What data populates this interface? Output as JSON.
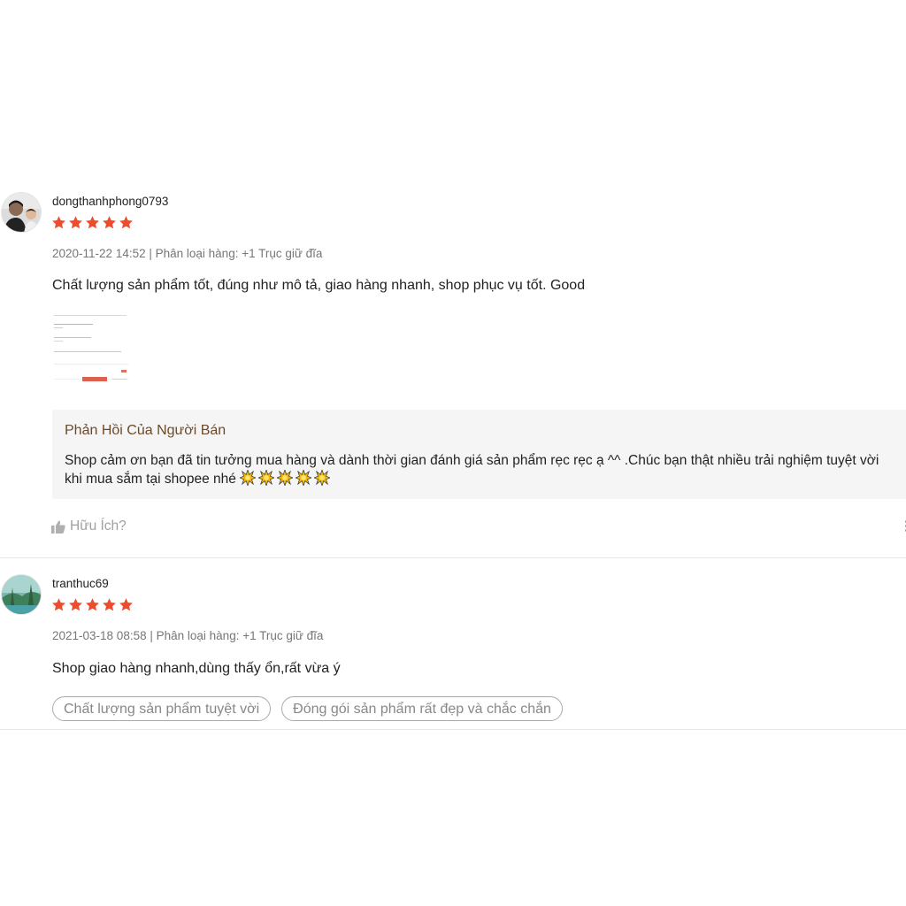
{
  "reviews": [
    {
      "username": "dongthanhphong0793",
      "rating": 5,
      "date": "2020-11-22 14:52",
      "variation": "Phân loại hàng: +1 Trục giữ đĩa",
      "comment": "Chất lượng sản phẩm tốt, đúng như mô tả, giao hàng nhanh, shop phục vụ tốt. Good",
      "seller_reply": {
        "title": "Phản Hồi Của Người Bán",
        "text": "Shop cảm ơn bạn đã tin tưởng mua hàng và dành thời gian đánh giá sản phẩm rẹc rẹc ạ ^^ .Chúc bạn thật nhiều trải nghiệm tuyệt vời khi mua sắm tại shopee nhé"
      },
      "helpful_label": "Hữu Ích?"
    },
    {
      "username": "tranthuc69",
      "rating": 5,
      "date": "2021-03-18 08:58",
      "variation": "Phân loại hàng: +1 Trục giữ đĩa",
      "comment": "Shop giao hàng nhanh,dùng thấy ổn,rất vừa ý",
      "tags": [
        "Chất lượng sản phẩm tuyệt vời",
        "Đóng gói sản phẩm rất đẹp và chắc chắn"
      ]
    }
  ],
  "colors": {
    "star": "#ee4d2d",
    "reply_title": "#6b4a2b",
    "reply_bg": "#f5f5f5",
    "meta": "#767676"
  },
  "icons": {
    "star": "star-icon",
    "sparkle": "sparkle-icon",
    "thumbs_up": "thumbs-up-icon",
    "more": "more-vertical-icon"
  }
}
